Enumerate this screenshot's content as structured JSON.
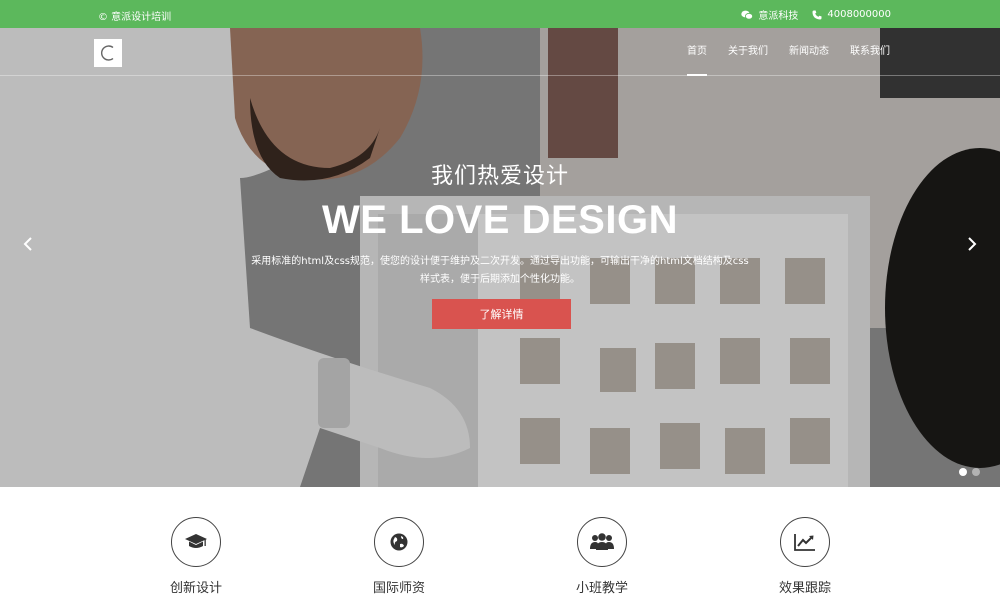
{
  "topbar": {
    "copyright": "© 意派设计培训",
    "wechat": "意派科技",
    "phone": "4008000000"
  },
  "nav": {
    "logo_letter": "C",
    "items": [
      {
        "label": "首页",
        "active": true
      },
      {
        "label": "关于我们"
      },
      {
        "label": "新闻动态"
      },
      {
        "label": "联系我们"
      }
    ]
  },
  "hero": {
    "subtitle": "我们热爱设计",
    "title": "WE LOVE DESIGN",
    "description": "采用标准的html及css规范，使您的设计便于维护及二次开发。通过导出功能，可输出干净的html文档结构及css样式表，便于后期添加个性化功能。",
    "button": "了解详情",
    "slides": 2,
    "active_slide": 1
  },
  "features": [
    {
      "label": "创新设计",
      "icon": "graduation-cap-icon"
    },
    {
      "label": "国际师资",
      "icon": "globe-icon"
    },
    {
      "label": "小班教学",
      "icon": "users-icon"
    },
    {
      "label": "效果跟踪",
      "icon": "line-chart-icon"
    }
  ],
  "colors": {
    "topbar": "#5cb85c",
    "button": "#d9534f"
  }
}
